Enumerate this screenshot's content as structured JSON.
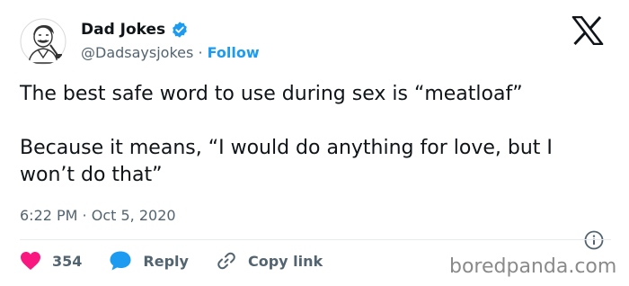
{
  "author": {
    "name": "Dad Jokes",
    "handle": "@Dadsaysjokes",
    "separator": "·",
    "follow_label": "Follow"
  },
  "tweet": {
    "line1": "The best safe word to use during sex is “meatloaf”",
    "line2": "Because it means, “I would do anything for love, but I won’t do that”"
  },
  "timestamp": "6:22 PM · Oct 5, 2020",
  "actions": {
    "likes_count": "354",
    "reply_label": "Reply",
    "copy_link_label": "Copy link"
  },
  "watermark": "boredpanda.com",
  "colors": {
    "accent": "#1d9bf0",
    "like": "#f91880",
    "text": "#0f1419",
    "muted": "#536471"
  },
  "icons": [
    "avatar-illustration",
    "verified-badge-icon",
    "x-logo-icon",
    "info-icon",
    "heart-icon",
    "reply-bubble-icon",
    "link-icon"
  ]
}
